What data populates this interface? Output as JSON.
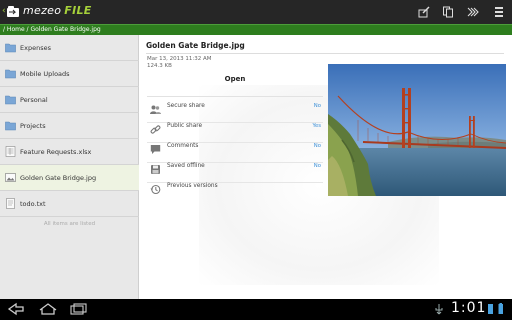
{
  "app": {
    "brand_part1": "mezeo",
    "brand_part2": "FILE"
  },
  "toolbar": {
    "actions": [
      "edit-icon",
      "copy-icon",
      "fast-forward-icon",
      "menu-overflow-icon"
    ]
  },
  "breadcrumb": {
    "path": "/ Home / Golden Gate Bridge.jpg"
  },
  "file_list": {
    "items": [
      {
        "label": "Expenses",
        "icon": "folder-icon",
        "selected": false
      },
      {
        "label": "Mobile Uploads",
        "icon": "folder-icon",
        "selected": false
      },
      {
        "label": "Personal",
        "icon": "folder-icon",
        "selected": false
      },
      {
        "label": "Projects",
        "icon": "folder-icon",
        "selected": false
      },
      {
        "label": "Feature Requests.xlsx",
        "icon": "spreadsheet-file-icon",
        "selected": false
      },
      {
        "label": "Golden Gate Bridge.jpg",
        "icon": "image-file-icon",
        "selected": true
      },
      {
        "label": "todo.txt",
        "icon": "text-file-icon",
        "selected": false
      }
    ],
    "footer": "All items are listed"
  },
  "detail": {
    "title": "Golden Gate Bridge.jpg",
    "date": "Mar 13, 2013 11:32 AM",
    "size": "124.3 KB",
    "open_label": "Open",
    "options": [
      {
        "label": "Secure share",
        "value": "No",
        "icon": "users-icon"
      },
      {
        "label": "Public share",
        "value": "Yes",
        "icon": "link-icon"
      },
      {
        "label": "Comments",
        "value": "No",
        "icon": "comment-icon"
      },
      {
        "label": "Saved offline",
        "value": "No",
        "icon": "save-icon"
      },
      {
        "label": "Previous versions",
        "value": "",
        "icon": "history-icon"
      }
    ]
  },
  "system": {
    "clock": "1:01"
  },
  "colors": {
    "brand_green": "#a6d13a",
    "crumb_bar": "#2e7d1e",
    "value_blue": "#3a8fd8"
  }
}
